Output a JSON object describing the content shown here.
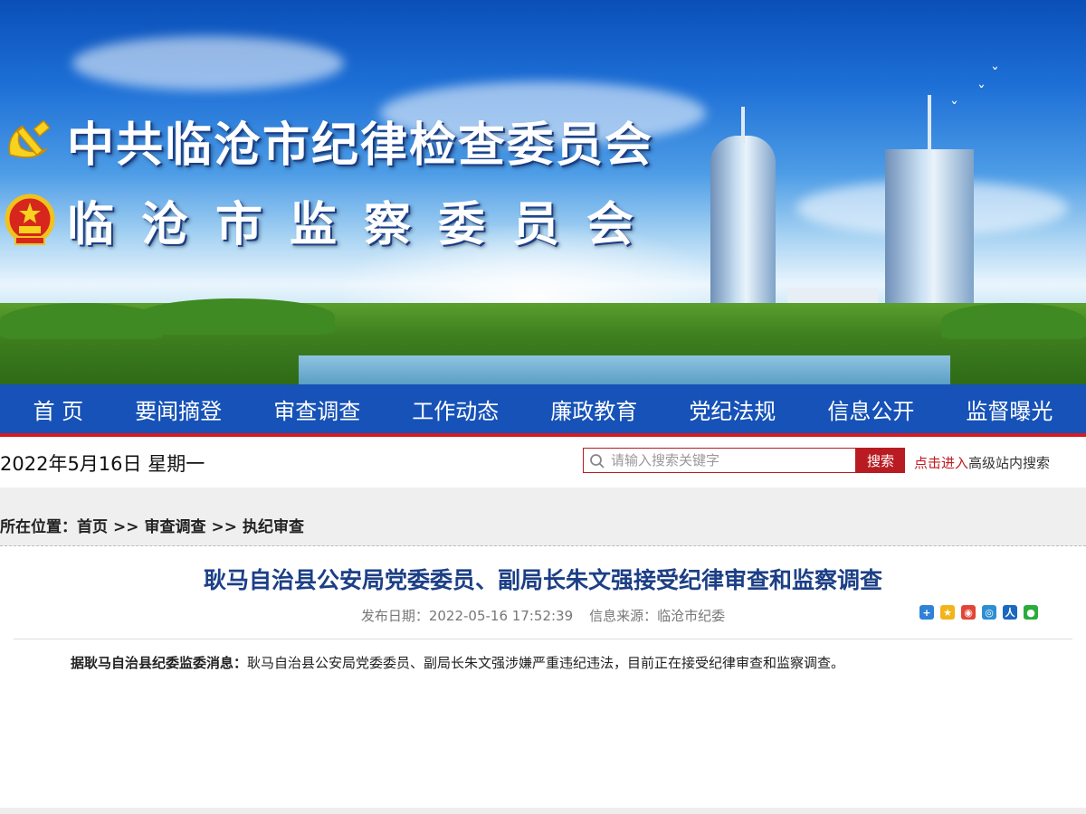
{
  "banner": {
    "title_line1": "中共临沧市纪律检查委员会",
    "title_line2": "临沧市监察委员会"
  },
  "nav": {
    "items": [
      "首 页",
      "要闻摘登",
      "审查调查",
      "工作动态",
      "廉政教育",
      "党纪法规",
      "信息公开",
      "监督曝光"
    ]
  },
  "info_bar": {
    "date": "2022年5月16日 星期一",
    "search_placeholder": "请输入搜索关键字",
    "search_button": "搜索",
    "advanced_link_red": "点击进入",
    "advanced_link_rest": "高级站内搜索"
  },
  "breadcrumb": {
    "label": "所在位置：",
    "items": [
      "首页",
      "审查调查",
      "执纪审查"
    ],
    "separator": ">>"
  },
  "article": {
    "title": "耿马自治县公安局党委委员、副局长朱文强接受纪律审查和监察调查",
    "publish_date": "发布日期：2022-05-16 17:52:39",
    "source": "信息来源：临沧市纪委",
    "lead_bold": "据耿马自治县纪委监委消息：",
    "body": "耿马自治县公安局党委委员、副局长朱文强涉嫌严重违纪违法，目前正在接受纪律审查和监察调查。"
  },
  "share_icons": [
    "share-more-icon",
    "qzone-icon",
    "weibo-icon",
    "tencent-weibo-icon",
    "renren-icon",
    "wechat-icon"
  ],
  "colors": {
    "nav_bg": "#1652b7",
    "accent_red": "#b81c22",
    "title_blue": "#1c3f86"
  }
}
